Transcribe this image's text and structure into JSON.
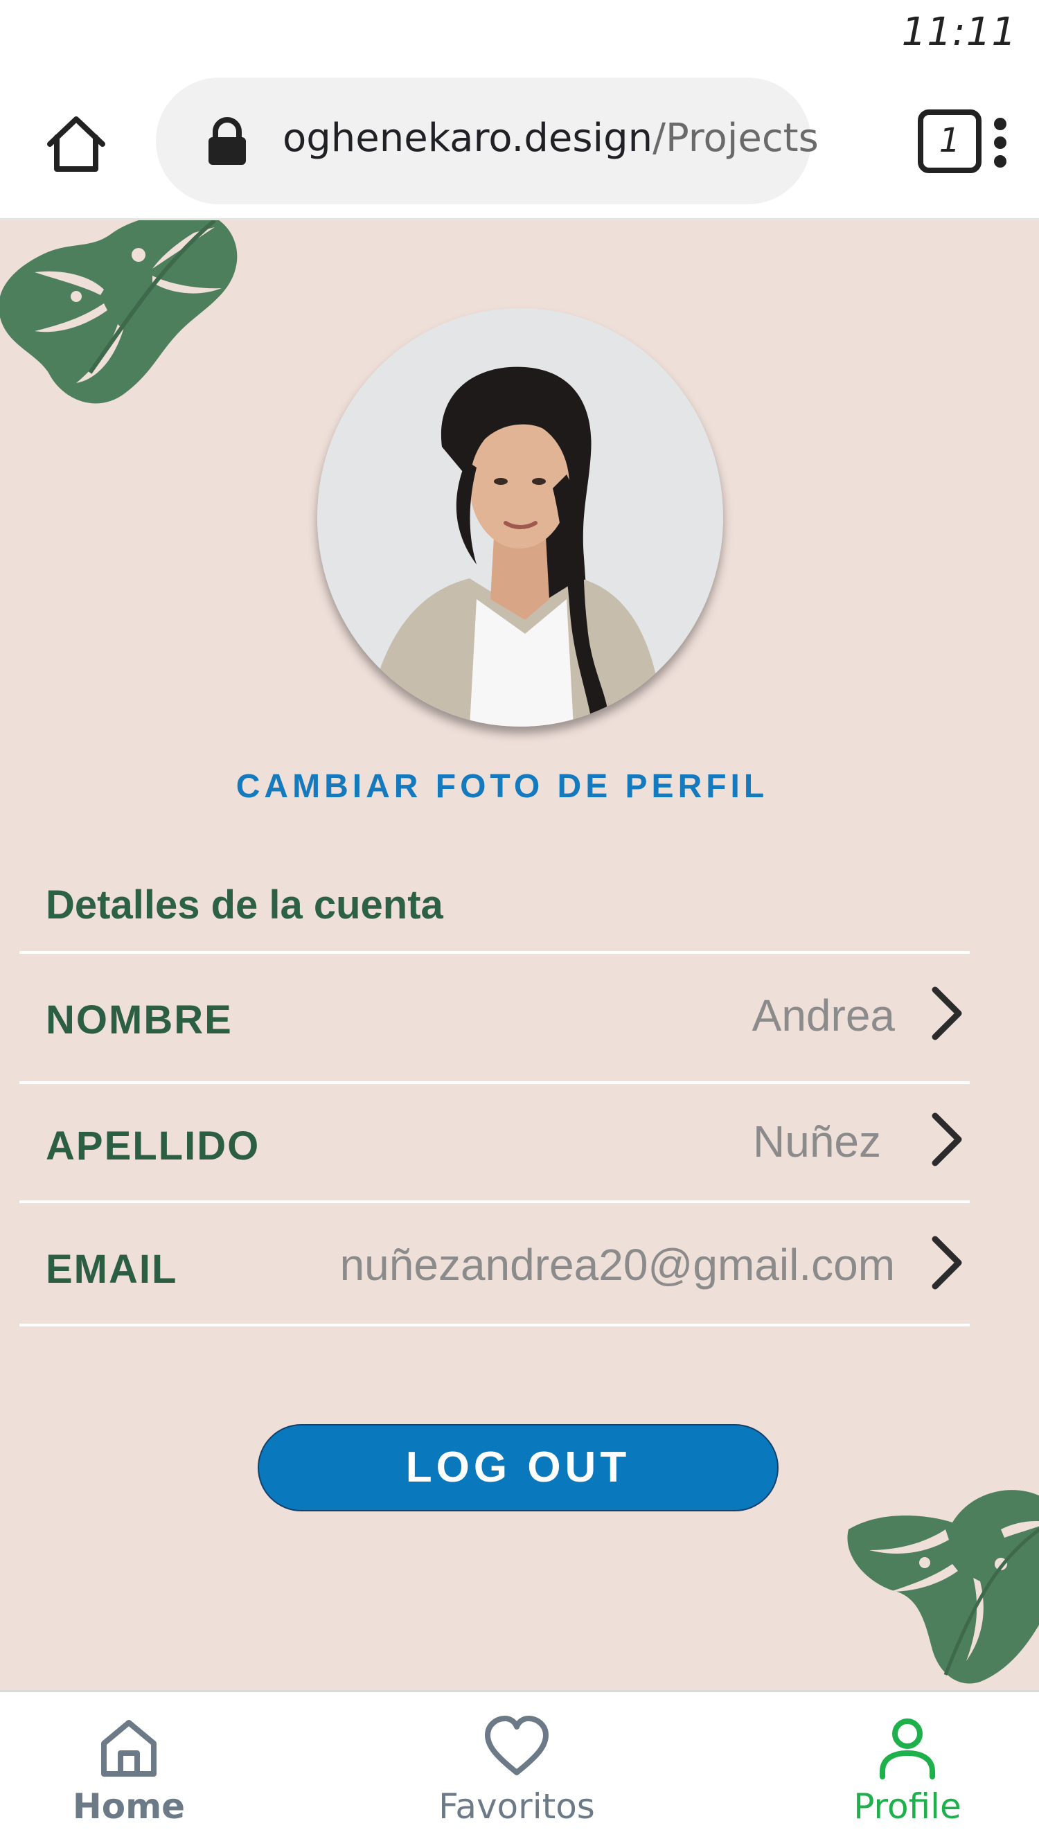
{
  "status_bar": {
    "time": "11:11"
  },
  "browser": {
    "url_domain": "oghenekaro.design",
    "url_path": "/Projects",
    "tab_count": "1"
  },
  "profile": {
    "change_photo_label": "CAMBIAR FOTO DE PERFIL",
    "section_title": "Detalles de la cuenta",
    "fields": [
      {
        "label": "NOMBRE",
        "value": "Andrea"
      },
      {
        "label": "APELLIDO",
        "value": "Nuñez"
      },
      {
        "label": "EMAIL",
        "value": "nuñezandrea20@gmail.com"
      }
    ],
    "logout_label": "LOG OUT"
  },
  "bottom_nav": {
    "items": [
      {
        "label": "Home",
        "icon": "home-icon",
        "color": "#6b7a86"
      },
      {
        "label": "Favoritos",
        "icon": "heart-icon",
        "color": "#6b7a86"
      },
      {
        "label": "Profile",
        "icon": "person-icon",
        "color": "#1db04b"
      }
    ]
  },
  "colors": {
    "background": "#efdfd9",
    "accent_blue": "#0a78bd",
    "label_green": "#2c5e44",
    "active_green": "#1db04b",
    "leaf_green": "#4e7f5c"
  }
}
